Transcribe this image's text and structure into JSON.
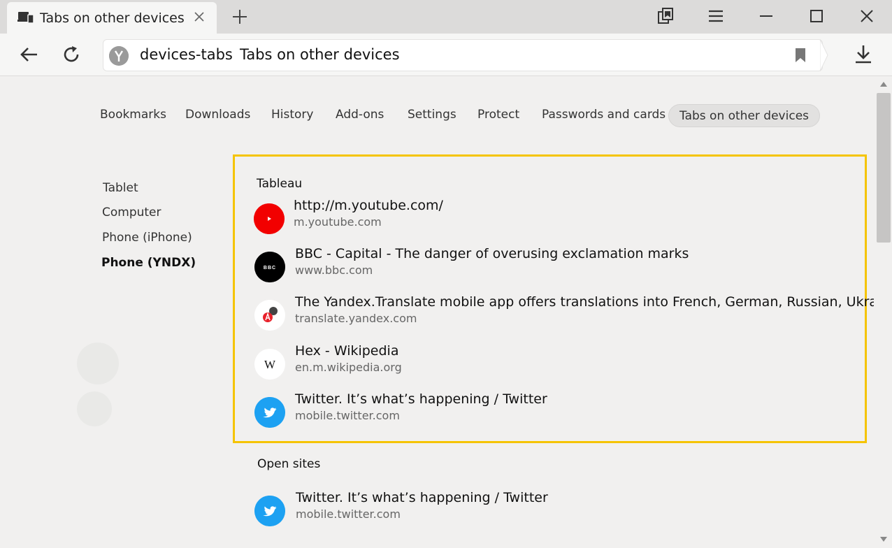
{
  "tab": {
    "title": "Tabs on other devices"
  },
  "address": {
    "host": "devices-tabs",
    "page_title": "Tabs on other devices"
  },
  "nav": {
    "items": [
      {
        "label": "Bookmarks"
      },
      {
        "label": "Downloads"
      },
      {
        "label": "History"
      },
      {
        "label": "Add-ons"
      },
      {
        "label": "Settings"
      },
      {
        "label": "Protect"
      },
      {
        "label": "Passwords and cards"
      },
      {
        "label": "Tabs on other devices"
      }
    ]
  },
  "devices": {
    "items": [
      {
        "label": "Tablet"
      },
      {
        "label": "Computer"
      },
      {
        "label": "Phone (iPhone)"
      },
      {
        "label": "Phone (YNDX)"
      }
    ]
  },
  "tableau": {
    "title": "Tableau",
    "items": [
      {
        "title": "http://m.youtube.com/",
        "url": "m.youtube.com",
        "icon": "youtube-icon"
      },
      {
        "title": "BBC - Capital - The danger of overusing exclamation marks",
        "url": "www.bbc.com",
        "icon": "bbc-icon",
        "badge": "BBC"
      },
      {
        "title": "The Yandex.Translate mobile app offers translations into French, German, Russian, Ukrainian",
        "url": "translate.yandex.com",
        "icon": "translate-icon"
      },
      {
        "title": "Hex - Wikipedia",
        "url": "en.m.wikipedia.org",
        "icon": "wikipedia-icon",
        "badge": "W"
      },
      {
        "title": "Twitter. It’s what’s happening / Twitter",
        "url": "mobile.twitter.com",
        "icon": "twitter-icon"
      }
    ]
  },
  "open_sites": {
    "title": "Open sites",
    "items": [
      {
        "title": "Twitter. It’s what’s happening / Twitter",
        "url": "mobile.twitter.com",
        "icon": "twitter-icon"
      }
    ]
  },
  "colors": {
    "highlight": "#f5c400",
    "youtube": "#f20000",
    "twitter": "#1da1f2"
  }
}
